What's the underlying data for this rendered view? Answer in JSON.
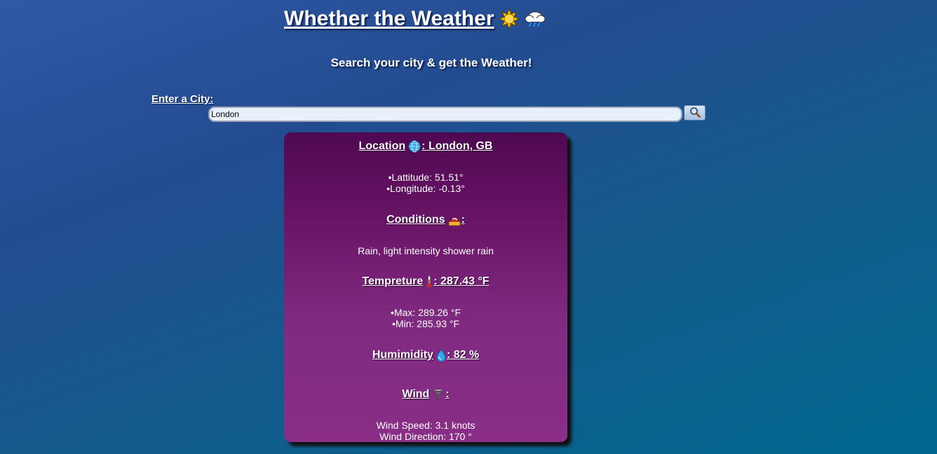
{
  "header": {
    "title": "Whether the Weather",
    "subtitle": "Search your city & get the Weather!"
  },
  "search": {
    "label": "Enter a City:",
    "value": "London",
    "button_icon": "search-icon"
  },
  "card": {
    "location_label": "Location",
    "location_value": ": London, GB",
    "latitude": "•Lattitude: 51.51°",
    "longitude": "•Longitude: -0.13°",
    "conditions_label": "Conditions",
    "conditions_suffix": ":",
    "conditions_value": "Rain, light intensity shower rain",
    "temperature_label": "Tempreture",
    "temperature_value": ": 287.43 °F",
    "temp_max": "•Max: 289.26 °F",
    "temp_min": "•Min: 285.93 °F",
    "humidity_label": "Humimidity",
    "humidity_value": ": 82 %",
    "wind_label": "Wind",
    "wind_suffix": ":",
    "wind_speed": "Wind Speed: 3.1 knots",
    "wind_direction": "Wind Direction: 170 °"
  },
  "icons": {
    "title_icons": [
      "sun-icon",
      "cloud-rain-icon"
    ],
    "location_icon": "globe-icon",
    "conditions_icon": "weather-conditions-icon",
    "temperature_icon": "thermometer-icon",
    "humidity_icon": "droplet-icon",
    "wind_icon": "tornado-icon"
  }
}
